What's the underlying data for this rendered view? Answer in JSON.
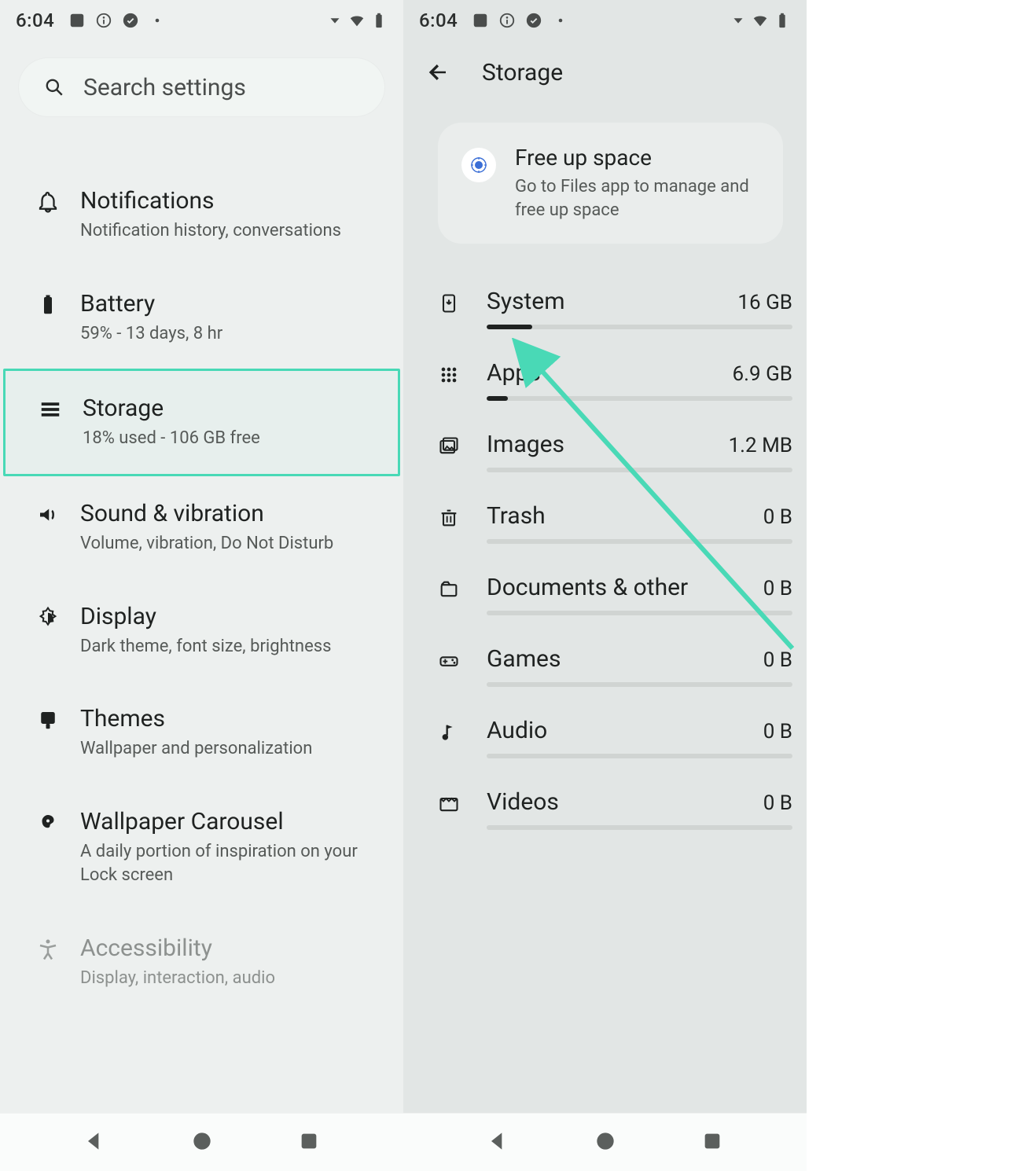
{
  "statusbar": {
    "time": "6:04"
  },
  "left": {
    "search_placeholder": "Search settings",
    "items": [
      {
        "key": "notifications",
        "title": "Notifications",
        "subtitle": "Notification history, conversations"
      },
      {
        "key": "battery",
        "title": "Battery",
        "subtitle": "59% - 13 days, 8 hr"
      },
      {
        "key": "storage",
        "title": "Storage",
        "subtitle": "18% used - 106 GB free",
        "selected": true
      },
      {
        "key": "sound",
        "title": "Sound & vibration",
        "subtitle": "Volume, vibration, Do Not Disturb"
      },
      {
        "key": "display",
        "title": "Display",
        "subtitle": "Dark theme, font size, brightness"
      },
      {
        "key": "themes",
        "title": "Themes",
        "subtitle": "Wallpaper and personalization"
      },
      {
        "key": "wallpaper",
        "title": "Wallpaper Carousel",
        "subtitle": "A daily portion of inspiration on your Lock screen"
      },
      {
        "key": "accessibility",
        "title": "Accessibility",
        "subtitle": "Display, interaction, audio",
        "faded": true
      }
    ]
  },
  "right": {
    "header": "Storage",
    "card": {
      "title": "Free up space",
      "desc": "Go to Files app to manage and free up space"
    },
    "rows": [
      {
        "key": "system",
        "title": "System",
        "value": "16 GB",
        "fillPct": 15
      },
      {
        "key": "apps",
        "title": "Apps",
        "value": "6.9 GB",
        "fillPct": 7,
        "pointer": true
      },
      {
        "key": "images",
        "title": "Images",
        "value": "1.2 MB",
        "fillPct": 0
      },
      {
        "key": "trash",
        "title": "Trash",
        "value": "0 B",
        "fillPct": 0
      },
      {
        "key": "documents",
        "title": "Documents & other",
        "value": "0 B",
        "fillPct": 0
      },
      {
        "key": "games",
        "title": "Games",
        "value": "0 B",
        "fillPct": 0
      },
      {
        "key": "audio",
        "title": "Audio",
        "value": "0 B",
        "fillPct": 0
      },
      {
        "key": "videos",
        "title": "Videos",
        "value": "0 B",
        "fillPct": 0
      }
    ]
  },
  "annotation": {
    "highlight_color": "#49d9b6",
    "arrow_color": "#49d9b6"
  }
}
